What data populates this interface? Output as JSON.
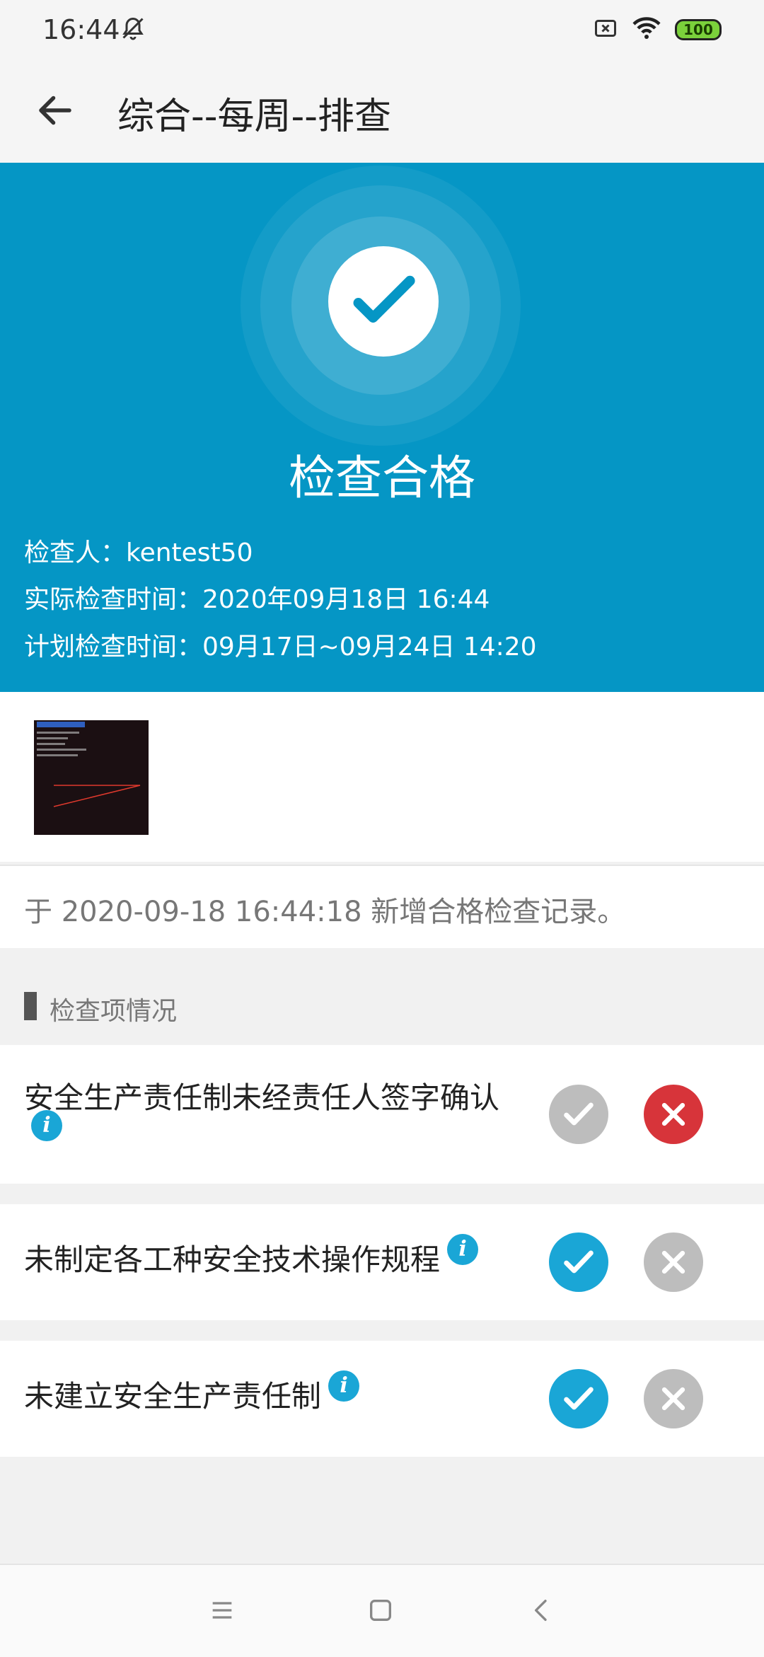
{
  "status_bar": {
    "time": "16:44",
    "battery": "100"
  },
  "app_bar": {
    "title": "综合--每周--排查"
  },
  "result": {
    "status": "检查合格",
    "inspector": "检查人：kentest50",
    "actual_time": "实际检查时间：2020年09月18日 16:44",
    "planned_time": "计划检查时间：09月17日~09月24日 14:20"
  },
  "record": {
    "text": "于 2020-09-18 16:44:18 新增合格检查记录。"
  },
  "section": {
    "title": "检查项情况"
  },
  "items": [
    {
      "label": "安全生产责任制未经责任人签字确认",
      "selected": "fail"
    },
    {
      "label": "未制定各工种安全技术操作规程",
      "selected": "pass"
    },
    {
      "label": "未建立安全生产责任制",
      "selected": "pass"
    }
  ],
  "info_glyph": "i",
  "colors": {
    "primary": "#0596c5",
    "pass": "#1aa6d6",
    "fail": "#d7343a",
    "inactive": "#bdbdbd"
  }
}
